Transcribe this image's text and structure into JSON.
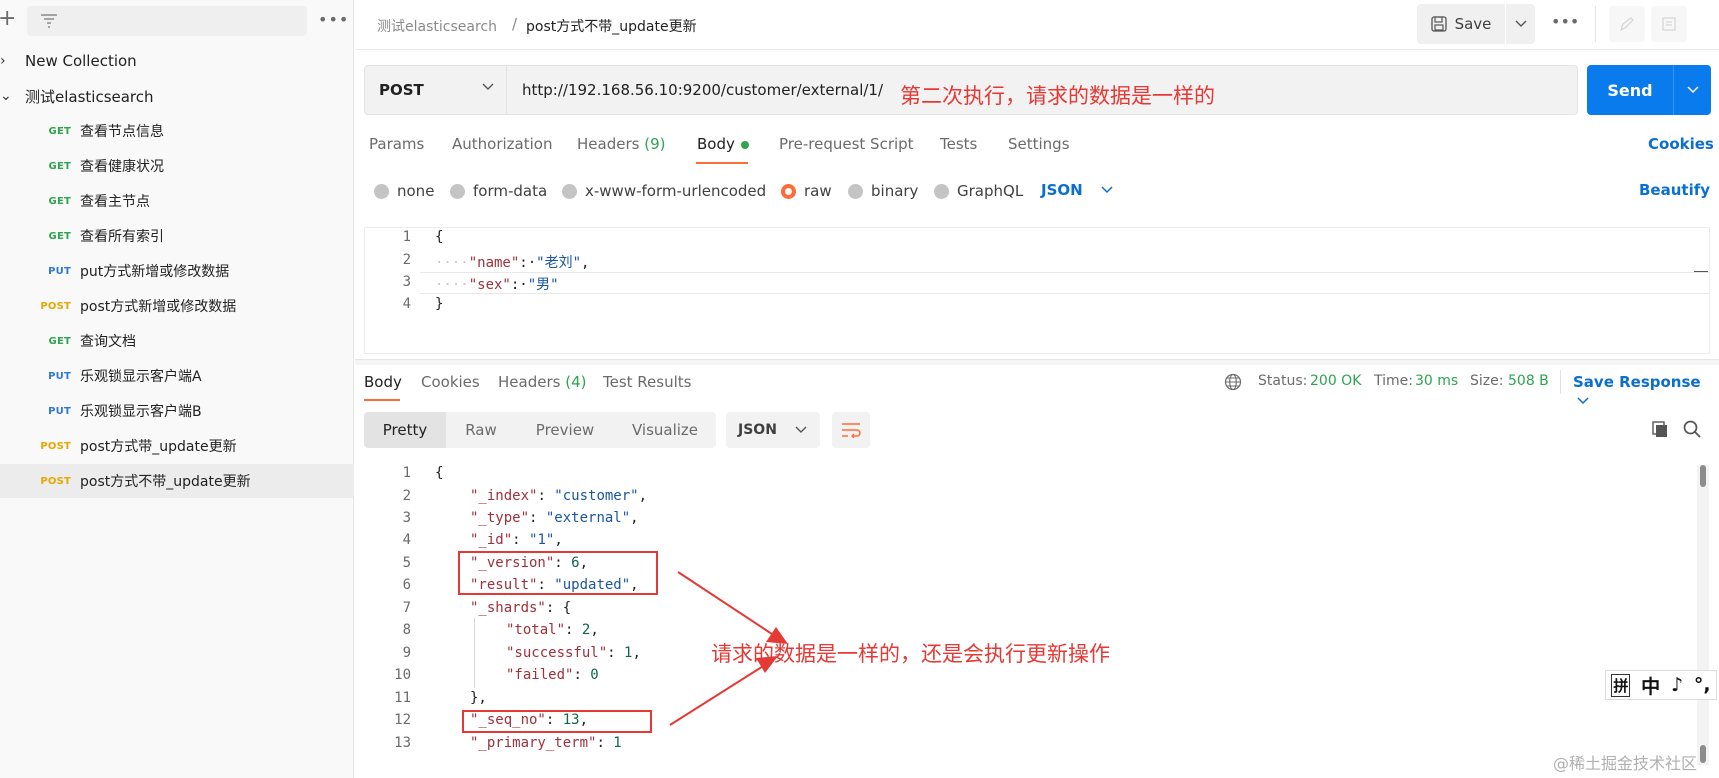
{
  "sidebar": {
    "collections": [
      {
        "name": "New Collection",
        "expanded": false
      },
      {
        "name": "测试elasticsearch",
        "expanded": true
      }
    ],
    "requests": [
      {
        "method": "GET",
        "name": "查看节点信息"
      },
      {
        "method": "GET",
        "name": "查看健康状况"
      },
      {
        "method": "GET",
        "name": "查看主节点"
      },
      {
        "method": "GET",
        "name": "查看所有索引"
      },
      {
        "method": "PUT",
        "name": "put方式新增或修改数据"
      },
      {
        "method": "POST",
        "name": "post方式新增或修改数据"
      },
      {
        "method": "GET",
        "name": "查询文档"
      },
      {
        "method": "PUT",
        "name": "乐观锁显示客户端A"
      },
      {
        "method": "PUT",
        "name": "乐观锁显示客户端B"
      },
      {
        "method": "POST",
        "name": "post方式带_update更新"
      },
      {
        "method": "POST",
        "name": "post方式不带_update更新"
      }
    ],
    "active_request_index": 10
  },
  "header": {
    "breadcrumb_parent": "测试elasticsearch",
    "breadcrumb_sep": "/",
    "breadcrumb_current": "post方式不带_update更新",
    "save_label": "Save"
  },
  "request": {
    "method": "POST",
    "url": "http://192.168.56.10:9200/customer/external/1/",
    "send_label": "Send",
    "tabs": [
      {
        "label": "Params"
      },
      {
        "label": "Authorization"
      },
      {
        "label": "Headers",
        "count": "(9)"
      },
      {
        "label": "Body"
      },
      {
        "label": "Pre-request Script"
      },
      {
        "label": "Tests"
      },
      {
        "label": "Settings"
      }
    ],
    "cookies_label": "Cookies",
    "body_types": [
      "none",
      "form-data",
      "x-www-form-urlencoded",
      "raw",
      "binary",
      "GraphQL"
    ],
    "selected_body_type": "raw",
    "raw_language": "JSON",
    "beautify_label": "Beautify",
    "body_lines": [
      "1",
      "2",
      "3",
      "4"
    ],
    "body": {
      "name_key": "\"name\"",
      "name_val": "\"老刘\"",
      "sex_key": "\"sex\"",
      "sex_val": "\"男\""
    }
  },
  "annotations": {
    "top": "第二次执行，请求的数据是一样的",
    "middle": "请求的数据是一样的，还是会执行更新操作"
  },
  "response": {
    "tabs": [
      {
        "label": "Body"
      },
      {
        "label": "Cookies"
      },
      {
        "label": "Headers",
        "count": "(4)"
      },
      {
        "label": "Test Results"
      }
    ],
    "status_label": "Status:",
    "status_value": "200 OK",
    "time_label": "Time:",
    "time_value": "30 ms",
    "size_label": "Size:",
    "size_value": "508 B",
    "save_response_label": "Save Response",
    "view_modes": [
      "Pretty",
      "Raw",
      "Preview",
      "Visualize"
    ],
    "format": "JSON",
    "line_numbers": [
      "1",
      "2",
      "3",
      "4",
      "5",
      "6",
      "7",
      "8",
      "9",
      "10",
      "11",
      "12",
      "13"
    ],
    "json": {
      "index_key": "\"_index\"",
      "index_val": "\"customer\"",
      "type_key": "\"_type\"",
      "type_val": "\"external\"",
      "id_key": "\"_id\"",
      "id_val": "\"1\"",
      "version_key": "\"_version\"",
      "version_val": "6",
      "result_key": "\"result\"",
      "result_val": "\"updated\"",
      "shards_key": "\"_shards\"",
      "total_key": "\"total\"",
      "total_val": "2",
      "successful_key": "\"successful\"",
      "successful_val": "1",
      "failed_key": "\"failed\"",
      "failed_val": "0",
      "seq_key": "\"_seq_no\"",
      "seq_val": "13",
      "primary_key": "\"_primary_term\"",
      "primary_val": "1"
    }
  },
  "ime": [
    "拼",
    "中",
    "♪",
    "°,"
  ],
  "watermark": "@稀土掘金技术社区",
  "colors": {
    "accent": "#ff6c37",
    "send": "#097bed",
    "annotation": "#e53935",
    "link": "#0a6fd1"
  }
}
